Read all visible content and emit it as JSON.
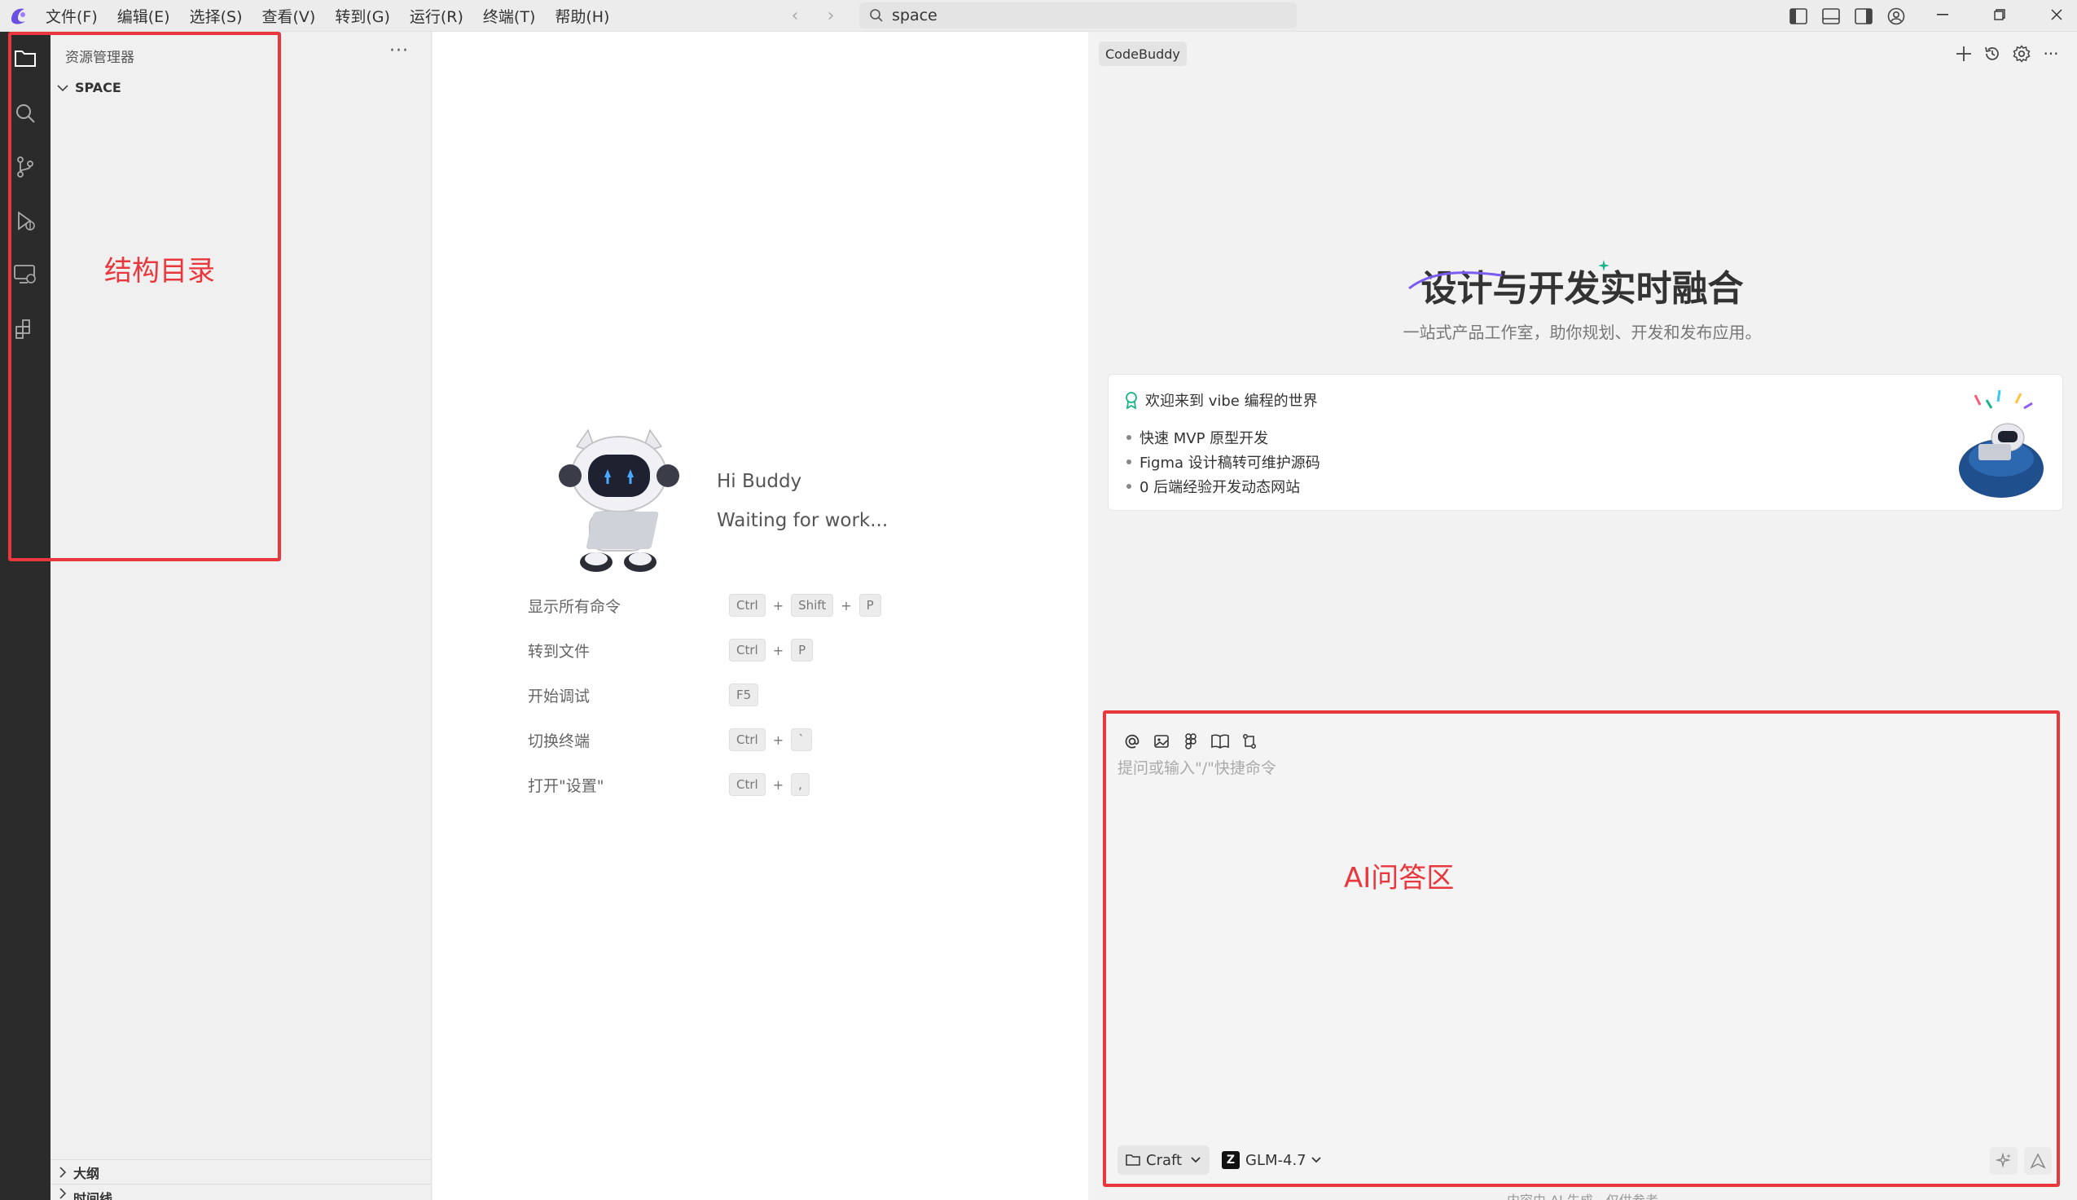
{
  "titlebar": {
    "menu": [
      "文件(F)",
      "编辑(E)",
      "选择(S)",
      "查看(V)",
      "转到(G)",
      "运行(R)",
      "终端(T)",
      "帮助(H)"
    ],
    "search_value": "space"
  },
  "sidebar": {
    "title": "资源管理器",
    "more": "···",
    "folder": "SPACE",
    "sections": [
      "大纲",
      "时间线"
    ]
  },
  "welcome": {
    "greeting": "Hi Buddy",
    "status": "Waiting for work...",
    "commands": [
      {
        "label": "显示所有命令",
        "keys": [
          "Ctrl",
          "Shift",
          "P"
        ]
      },
      {
        "label": "转到文件",
        "keys": [
          "Ctrl",
          "P"
        ]
      },
      {
        "label": "开始调试",
        "keys": [
          "F5"
        ]
      },
      {
        "label": "切换终端",
        "keys": [
          "Ctrl",
          "`"
        ]
      },
      {
        "label": "打开\"设置\"",
        "keys": [
          "Ctrl",
          ","
        ]
      }
    ]
  },
  "panel": {
    "tab": "CodeBuddy",
    "hero_title": "设计与开发实时融合",
    "hero_subtitle": "一站式产品工作室，助你规划、开发和发布应用。",
    "card": {
      "heading": "欢迎来到 vibe 编程的世界",
      "items": [
        "快速 MVP 原型开发",
        "Figma 设计稿转可维护源码",
        "0 后端经验开发动态网站"
      ]
    },
    "chat": {
      "placeholder": "提问或输入\"/\"快捷命令",
      "mode": "Craft",
      "model": "GLM-4.7",
      "disclaimer": "内容由 AI 生成，仅供参考"
    }
  },
  "annotations": {
    "left_label": "结构目录",
    "right_label": "AI问答区",
    "color": "#e8383d"
  },
  "colors": {
    "activity_bar": "#2b2b2b",
    "accent": "#2d6cdf"
  }
}
